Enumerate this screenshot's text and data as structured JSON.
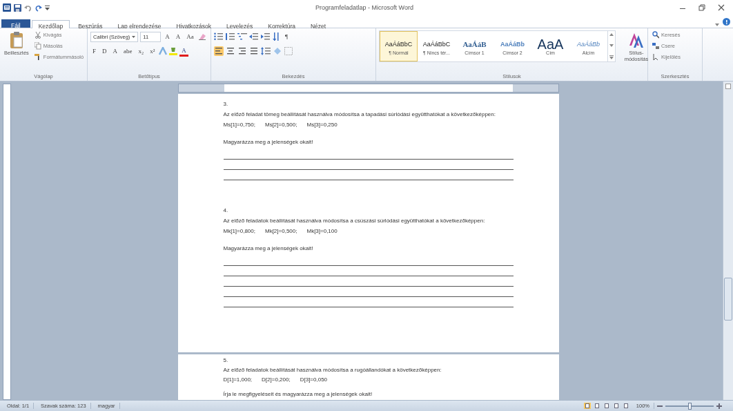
{
  "window": {
    "title": "Programfeladatlap - Microsoft Word"
  },
  "tabs": [
    {
      "label": "Fájl",
      "kind": "file",
      "selected": false
    },
    {
      "label": "Kezdőlap",
      "kind": "tab",
      "selected": true
    },
    {
      "label": "Beszúrás",
      "kind": "tab",
      "selected": false
    },
    {
      "label": "Lap elrendezése",
      "kind": "tab",
      "selected": false
    },
    {
      "label": "Hivatkozások",
      "kind": "tab",
      "selected": false
    },
    {
      "label": "Levelezés",
      "kind": "tab",
      "selected": false
    },
    {
      "label": "Korrektúra",
      "kind": "tab",
      "selected": false
    },
    {
      "label": "Nézet",
      "kind": "tab",
      "selected": false
    }
  ],
  "ribbon": {
    "clipboard": {
      "label": "Vágólap",
      "paste": "Beillesztés",
      "items": [
        "Kivágás",
        "Másolás",
        "Formátummásoló"
      ]
    },
    "font": {
      "label": "Betűtípus",
      "font_name": "Calibri (Szöveg)",
      "font_size": "11",
      "top_buttons": [
        "A",
        "A",
        "Aa"
      ],
      "bottom_buttons": [
        "F",
        "D",
        "A",
        "abe",
        "x₂",
        "x²"
      ],
      "font_color_button": "A"
    },
    "paragraph": {
      "label": "Bekezdés",
      "marks_button": "¶",
      "alignments": [
        {
          "selected": true
        },
        {
          "selected": false
        },
        {
          "selected": false
        },
        {
          "selected": false
        }
      ]
    },
    "styles": {
      "label": "Stílusok",
      "items": [
        {
          "preview": "AaÁáBbC",
          "name": "¶ Normál",
          "kind": "normal",
          "selected": true
        },
        {
          "preview": "AaÁáBbC",
          "name": "¶ Nincs tér...",
          "kind": "normal",
          "selected": false
        },
        {
          "preview": "AaÁáB",
          "name": "Címsor 1",
          "kind": "heading1",
          "selected": false
        },
        {
          "preview": "AaÁáBb",
          "name": "Címsor 2",
          "kind": "heading2",
          "selected": false
        },
        {
          "preview": "AaA",
          "name": "Cím",
          "kind": "title",
          "selected": false
        },
        {
          "preview": "AaÁáBb",
          "name": "Alcím",
          "kind": "subtitle",
          "selected": false
        }
      ],
      "change": "Stílus-módosítás"
    },
    "editing": {
      "label": "Szerkesztés",
      "items": [
        "Keresés",
        "Csere",
        "Kijelölés"
      ]
    }
  },
  "document": {
    "pages": [
      {
        "blocks": [
          {
            "kind": "number",
            "text": "3."
          },
          {
            "kind": "paragraph",
            "text": "Az előző feladat tömeg beállítását használva módosítsa a tapadási súrlódási együtthatókat a következőképpen:"
          },
          {
            "kind": "values",
            "items": [
              "Ms[1]=0,750;",
              "Ms[2]=0,500;",
              "Ms[3]=0,250"
            ]
          },
          {
            "kind": "question",
            "text": "Magyarázza meg a jelenségek okait!"
          },
          {
            "kind": "line"
          },
          {
            "kind": "line"
          },
          {
            "kind": "line"
          },
          {
            "kind": "number",
            "text": "4."
          },
          {
            "kind": "paragraph",
            "text": "Az előző feladatok beállítását használva módosítsa a csúszási súrlódási együtthatókat a következőképpen:"
          },
          {
            "kind": "values",
            "items": [
              "Mk[1]=0,800;",
              "Mk[2]=0,500;",
              "Mk[3]=0,100"
            ]
          },
          {
            "kind": "question",
            "text": "Magyarázza meg a jelenségek okait!"
          },
          {
            "kind": "line"
          },
          {
            "kind": "line"
          },
          {
            "kind": "line"
          },
          {
            "kind": "line"
          },
          {
            "kind": "line"
          }
        ]
      },
      {
        "blocks": [
          {
            "kind": "number",
            "text": "5."
          },
          {
            "kind": "paragraph",
            "text": "Az előző feladatok beállítását használva módosítsa a rugóállandókat a következőképpen:"
          },
          {
            "kind": "values",
            "items": [
              "D[1]=1,000;",
              "D[2]=0,200;",
              "D[3]=0,050"
            ]
          },
          {
            "kind": "question",
            "text": "Írja le megfigyeléseit és magyarázza meg a jelenségek okait!"
          }
        ]
      }
    ]
  },
  "status_bar": {
    "items": [
      "Oldal: 1/1",
      "Szavak száma: 123",
      "magyar"
    ],
    "zoom": {
      "label": "100%",
      "level": 0.5
    }
  }
}
